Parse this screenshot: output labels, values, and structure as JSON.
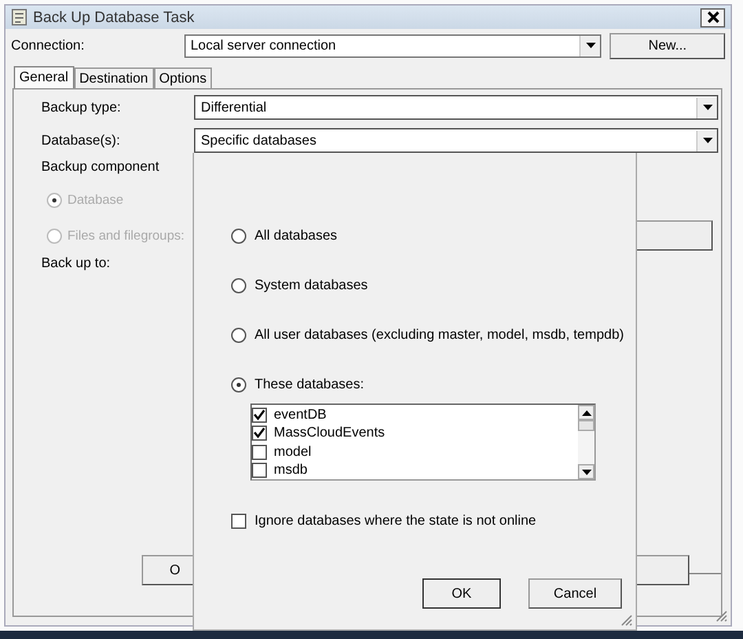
{
  "window": {
    "title": "Back Up Database Task"
  },
  "connection": {
    "label": "Connection:",
    "value": "Local server connection",
    "new_button": "New..."
  },
  "tabs": [
    {
      "label": "General",
      "selected": true
    },
    {
      "label": "Destination",
      "selected": false
    },
    {
      "label": "Options",
      "selected": false
    }
  ],
  "fields": [
    {
      "label": "Backup type:",
      "value": "Differential"
    },
    {
      "label": "Database(s):",
      "value": "Specific databases"
    }
  ],
  "backup_component": {
    "label": "Backup component",
    "options": [
      {
        "label": "Database",
        "selected": true,
        "disabled": true
      },
      {
        "label": "Files and filegroups:",
        "selected": false,
        "disabled": true
      }
    ]
  },
  "back_up_to": {
    "label": "Back up to:"
  },
  "ok_button": "O",
  "database_popup": {
    "options": [
      {
        "label": "All databases",
        "selected": false
      },
      {
        "label": "System databases",
        "selected": false
      },
      {
        "label": "All user databases  (excluding master, model, msdb, tempdb)",
        "selected": false
      },
      {
        "label": "These databases:",
        "selected": true
      }
    ],
    "databases": [
      {
        "name": "eventDB",
        "checked": true
      },
      {
        "name": "MassCloudEvents",
        "checked": true
      },
      {
        "name": "model",
        "checked": false
      },
      {
        "name": "msdb",
        "checked": false
      }
    ],
    "ignore_offline": {
      "label": "Ignore databases where the state is not online",
      "checked": false
    },
    "buttons": [
      "OK",
      "Cancel"
    ]
  }
}
